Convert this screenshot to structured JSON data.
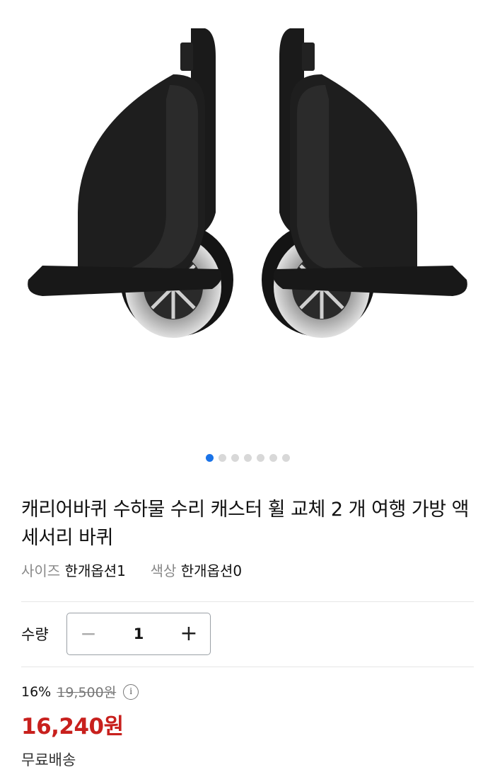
{
  "product": {
    "image_alt": "caster-wheel-pair",
    "title": "캐리어바퀴 수하물 수리 캐스터 휠 교체 2 개 여행 가방 액세서리 바퀴",
    "options": [
      {
        "label": "사이즈",
        "value": "한개옵션1"
      },
      {
        "label": "색상",
        "value": "한개옵션0"
      }
    ]
  },
  "gallery": {
    "slide_count": 7,
    "active_index": 0,
    "active_color": "#1a73e8"
  },
  "quantity": {
    "label": "수량",
    "value": "1",
    "minus_icon": "minus-icon",
    "plus_icon": "plus-icon"
  },
  "price": {
    "discount_percent": "16%",
    "original": "19,500원",
    "sale": "16,240원",
    "sale_color": "#c8201d",
    "shipping": "무료배송"
  }
}
